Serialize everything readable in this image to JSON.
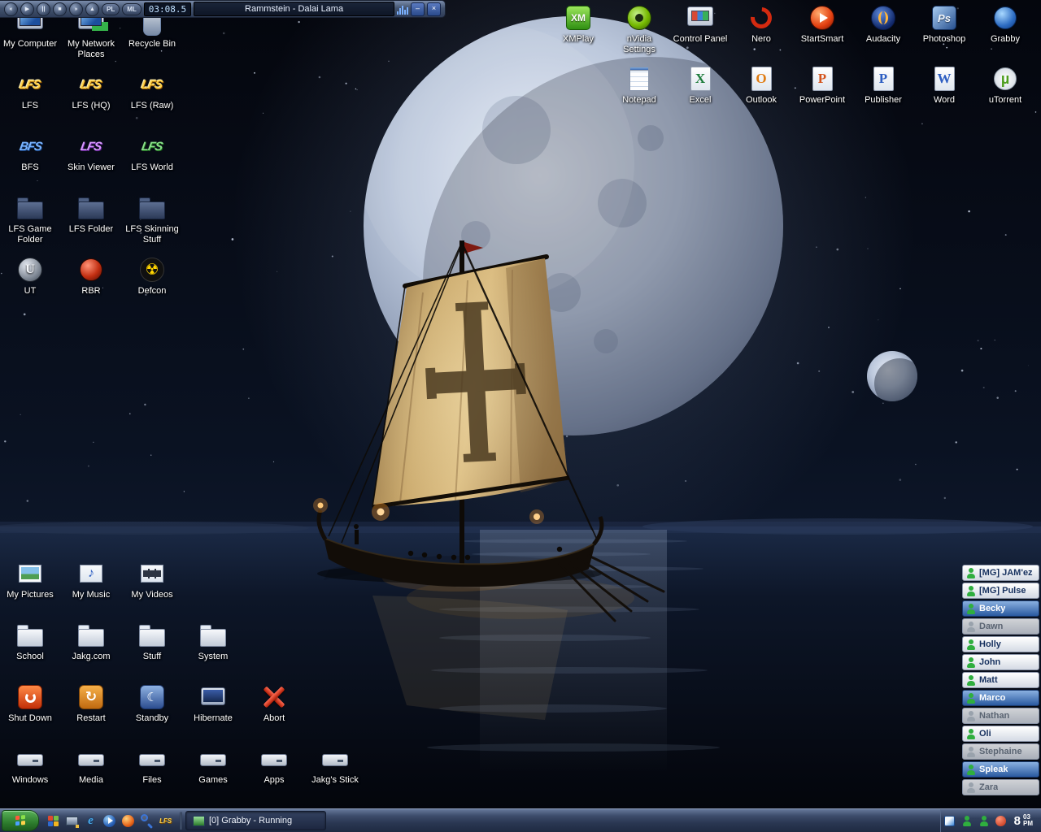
{
  "colors": {
    "selection_blue": "#2a5aa0",
    "online_green": "#2fae3e",
    "taskbar": "#2a3752",
    "sail": "#c9a86b",
    "moon": "#bcc8dc"
  },
  "player": {
    "time": "03:08.5",
    "title": "Rammstein - Dalai Lama",
    "pl": "PL",
    "ml": "ML",
    "minimize": "–",
    "close": "×",
    "transport": {
      "prev": "«",
      "play": "▶",
      "pause": "||",
      "stop": "■",
      "next": "»",
      "eject": "▲"
    }
  },
  "desktop": {
    "top_left": [
      {
        "label": "My Computer",
        "icon": "computer"
      },
      {
        "label": "My Network Places",
        "icon": "network"
      },
      {
        "label": "Recycle Bin",
        "icon": "recycle"
      },
      {
        "label": "LFS",
        "icon": "lfs",
        "glyph": "LFS"
      },
      {
        "label": "LFS (HQ)",
        "icon": "lfs",
        "glyph": "LFS"
      },
      {
        "label": "LFS (Raw)",
        "icon": "lfs",
        "glyph": "LFS"
      },
      {
        "label": "BFS",
        "icon": "bfs",
        "glyph": "BFS"
      },
      {
        "label": "Skin Viewer",
        "icon": "skin",
        "glyph": "LFS"
      },
      {
        "label": "LFS World",
        "icon": "world",
        "glyph": "LFS"
      },
      {
        "label": "LFS Game Folder",
        "icon": "folder"
      },
      {
        "label": "LFS Folder",
        "icon": "folder"
      },
      {
        "label": "LFS Skinning Stuff",
        "icon": "folder"
      },
      {
        "label": "UT",
        "icon": "ut",
        "glyph": "U"
      },
      {
        "label": "RBR",
        "icon": "rbr"
      },
      {
        "label": "Defcon",
        "icon": "defcon",
        "glyph": "☢"
      }
    ],
    "top_right_row1": [
      {
        "label": "XMPlay",
        "icon": "xmplay",
        "glyph": "XM"
      },
      {
        "label": "nVidia Settings",
        "icon": "nvidia"
      },
      {
        "label": "Control Panel",
        "icon": "controlpanel"
      },
      {
        "label": "Nero",
        "icon": "nero"
      },
      {
        "label": "StartSmart",
        "icon": "startsmart"
      },
      {
        "label": "Audacity",
        "icon": "audacity"
      },
      {
        "label": "Photoshop",
        "icon": "photoshop",
        "glyph": "Ps"
      },
      {
        "label": "Grabby",
        "icon": "grabby"
      }
    ],
    "top_right_row2": [
      {
        "label": "Notepad",
        "icon": "notepad"
      },
      {
        "label": "Excel",
        "icon": "excel",
        "glyph": "X"
      },
      {
        "label": "Outlook",
        "icon": "outlook",
        "glyph": "O"
      },
      {
        "label": "PowerPoint",
        "icon": "powerpoint",
        "glyph": "P"
      },
      {
        "label": "Publisher",
        "icon": "publisher",
        "glyph": "P"
      },
      {
        "label": "Word",
        "icon": "word",
        "glyph": "W"
      },
      {
        "label": "uTorrent",
        "icon": "utorrent",
        "glyph": "µ"
      }
    ],
    "bottom_row1": [
      {
        "label": "My Pictures",
        "icon": "pictures"
      },
      {
        "label": "My Music",
        "icon": "music",
        "glyph": "♪"
      },
      {
        "label": "My Videos",
        "icon": "videos"
      }
    ],
    "bottom_row2": [
      {
        "label": "School",
        "icon": "folder2"
      },
      {
        "label": "Jakg.com",
        "icon": "folder2"
      },
      {
        "label": "Stuff",
        "icon": "folder2"
      },
      {
        "label": "System",
        "icon": "folder2"
      }
    ],
    "bottom_row3": [
      {
        "label": "Shut Down",
        "icon": "shutdown"
      },
      {
        "label": "Restart",
        "icon": "restart",
        "glyph": "↻"
      },
      {
        "label": "Standby",
        "icon": "standby",
        "glyph": "☾"
      },
      {
        "label": "Hibernate",
        "icon": "hibernate"
      },
      {
        "label": "Abort",
        "icon": "abort"
      }
    ],
    "bottom_row4": [
      {
        "label": "Windows",
        "icon": "drive"
      },
      {
        "label": "Media",
        "icon": "drive"
      },
      {
        "label": "Files",
        "icon": "drive"
      },
      {
        "label": "Games",
        "icon": "drive"
      },
      {
        "label": "Apps",
        "icon": "drive"
      },
      {
        "label": "Jakg's Stick",
        "icon": "drive"
      }
    ]
  },
  "buddy_list": {
    "entries": [
      {
        "name": "[MG] JAM'ez",
        "status": "online"
      },
      {
        "name": "[MG] Pulse",
        "status": "online"
      },
      {
        "name": "Becky",
        "status": "selected"
      },
      {
        "name": "Dawn",
        "status": "offline"
      },
      {
        "name": "Holly",
        "status": "online"
      },
      {
        "name": "John",
        "status": "online"
      },
      {
        "name": "Matt",
        "status": "online"
      },
      {
        "name": "Marco",
        "status": "selected"
      },
      {
        "name": "Nathan",
        "status": "offline"
      },
      {
        "name": "Oli",
        "status": "online"
      },
      {
        "name": "Stephaine",
        "status": "offline"
      },
      {
        "name": "Spleak",
        "status": "selected"
      },
      {
        "name": "Zara",
        "status": "offline"
      }
    ]
  },
  "taskbar": {
    "task_label": "[0] Grabby - Running",
    "clock": {
      "hour": "8",
      "minute": "03",
      "ampm": "PM"
    },
    "quick_launch": [
      "windows",
      "show-desktop",
      "internet-explorer",
      "media-player",
      "firefox",
      "search",
      "lfs"
    ],
    "tray": [
      "graphics",
      "messenger",
      "messenger-2",
      "alert"
    ]
  }
}
